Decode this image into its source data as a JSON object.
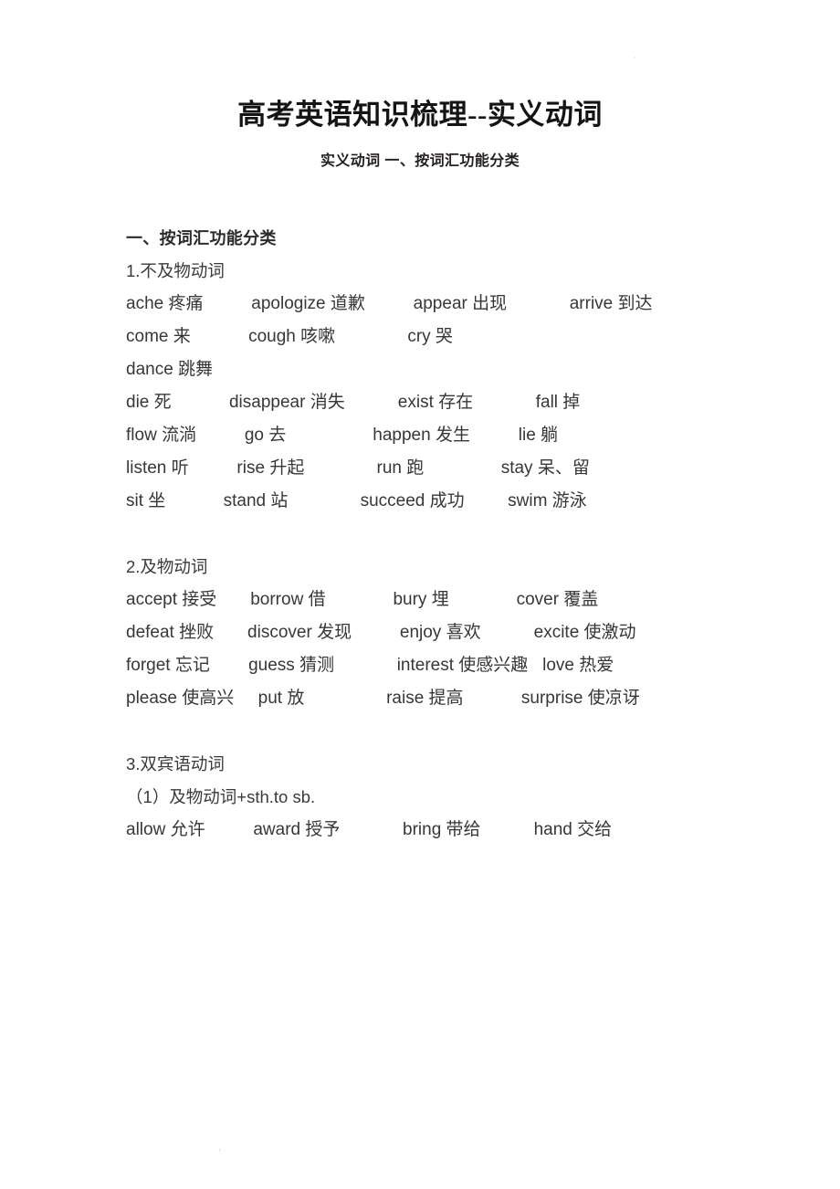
{
  "document": {
    "title": "高考英语知识梳理--实义动词",
    "subtitle": "实义动词 一、按词汇功能分类"
  },
  "artifacts": {
    "top_right_mark": "'",
    "bottom_left_mark": "'"
  },
  "content": {
    "section_heading": "一、按词汇功能分类",
    "groups": [
      {
        "label": "1.不及物动词",
        "lines": [
          "ache 疼痛          apologize 道歉          appear 出现             arrive 到达          come 来            cough 咳嗽               cry 哭",
          "dance 跳舞",
          "die 死            disappear 消失           exist 存在             fall 掉",
          "flow 流淌          go 去                  happen 发生          lie 躺",
          "listen 听          rise 升起               run 跑                stay 呆、留",
          "sit 坐            stand 站               succeed 成功         swim 游泳"
        ]
      },
      {
        "label": "2.及物动词",
        "lines": [
          "accept 接受       borrow 借              bury 埋              cover 覆盖",
          "defeat 挫败       discover 发现          enjoy 喜欢           excite 使激动",
          "forget 忘记        guess 猜测             interest 使感兴趣   love 热爱",
          "please 使高兴     put 放                 raise 提高            surprise 使凉讶"
        ]
      },
      {
        "label": "3.双宾语动词",
        "sub_label": "（1）及物动词+sth.to sb.",
        "lines": [
          "allow 允许          award 授予             bring 带给           hand 交给"
        ]
      }
    ]
  }
}
